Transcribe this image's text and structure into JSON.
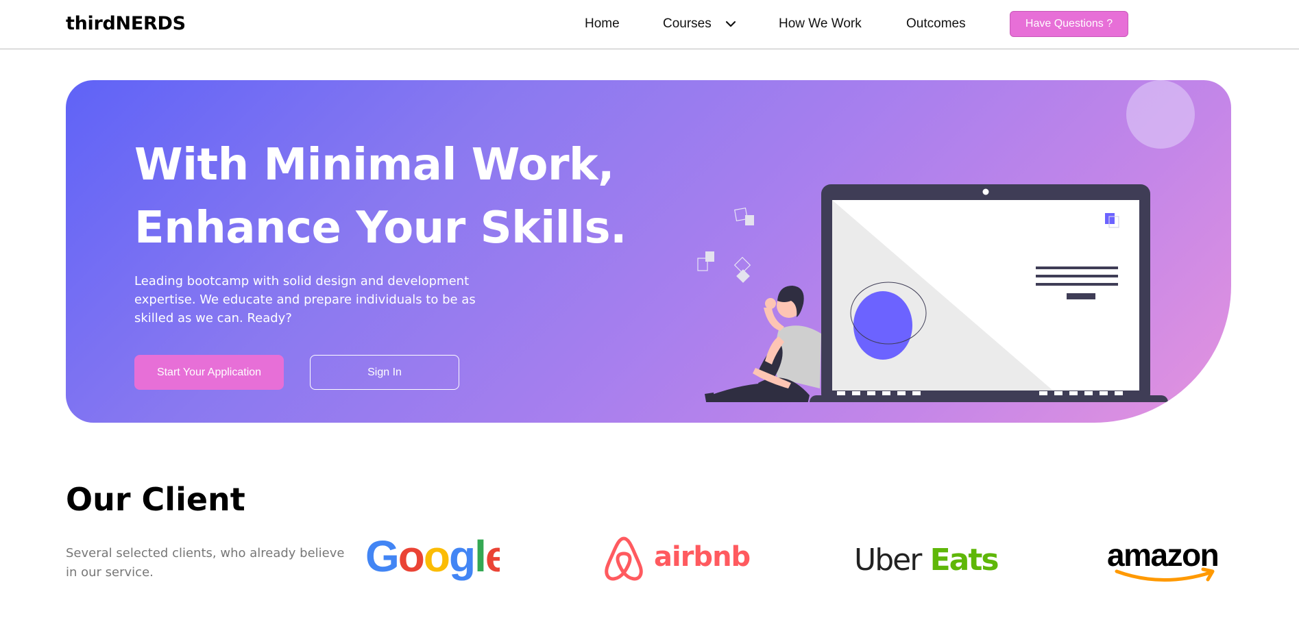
{
  "navbar": {
    "logo": "thirdNERDS",
    "items": [
      {
        "label": "Home"
      },
      {
        "label": "Courses"
      },
      {
        "label": "How We Work"
      },
      {
        "label": "Outcomes"
      }
    ],
    "cta_label": "Have Questions ?"
  },
  "hero": {
    "title_line1": "With Minimal Work,",
    "title_line2": "Enhance Your Skills.",
    "subtitle": "Leading bootcamp with solid design and development expertise. We educate and prepare individuals to be as skilled as we can. Ready?",
    "primary_button": "Start Your Application",
    "secondary_button": "Sign In"
  },
  "clients": {
    "title": "Our Client",
    "subtitle": "Several selected clients, who already believe in our service.",
    "logos": [
      {
        "name": "Google",
        "icon": "google-logo"
      },
      {
        "name": "airbnb",
        "icon": "airbnb-logo"
      },
      {
        "name": "Uber Eats",
        "icon": "uber-eats-logo"
      },
      {
        "name": "amazon",
        "icon": "amazon-logo"
      }
    ]
  },
  "colors": {
    "accent_pink": "#e76fd7",
    "hero_start": "#5f63f7",
    "hero_end": "#e493de",
    "laptop": "#3f3d56",
    "illustration_accent": "#6c63ff"
  }
}
